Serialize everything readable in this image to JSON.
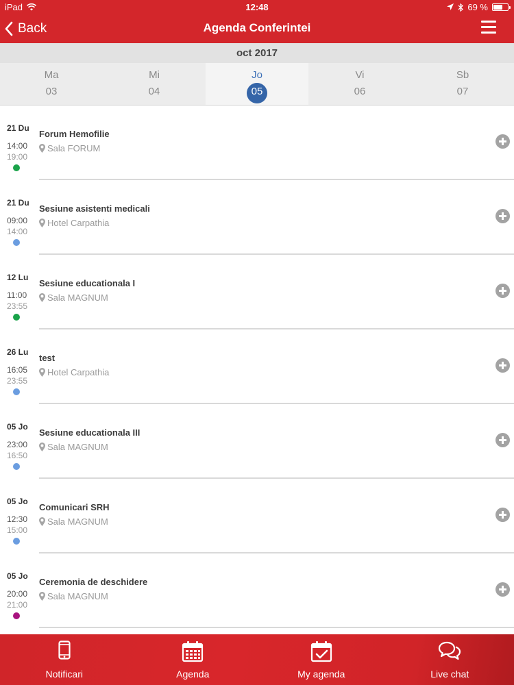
{
  "status": {
    "device": "iPad",
    "time": "12:48",
    "battery": "69 %",
    "battery_level": 0.69
  },
  "nav": {
    "back_label": "Back",
    "title": "Agenda Conferintei"
  },
  "calendar": {
    "month": "oct 2017",
    "days": [
      {
        "name": "Ma",
        "num": "03"
      },
      {
        "name": "Mi",
        "num": "04"
      },
      {
        "name": "Jo",
        "num": "05",
        "selected": true
      },
      {
        "name": "Vi",
        "num": "06"
      },
      {
        "name": "Sb",
        "num": "07"
      }
    ]
  },
  "events": [
    {
      "date": "21 Du",
      "start": "14:00",
      "end": "19:00",
      "title": "Forum Hemofilie",
      "location": "Sala FORUM",
      "dot_color": "#1aa34a"
    },
    {
      "date": "21 Du",
      "start": "09:00",
      "end": "14:00",
      "title": "Sesiune asistenti medicali",
      "location": "Hotel Carpathia",
      "dot_color": "#6b9de0"
    },
    {
      "date": "12 Lu",
      "start": "11:00",
      "end": "23:55",
      "title": "Sesiune educationala I",
      "location": "Sala MAGNUM",
      "dot_color": "#1aa34a"
    },
    {
      "date": "26 Lu",
      "start": "16:05",
      "end": "23:55",
      "title": "test",
      "location": "Hotel Carpathia",
      "dot_color": "#6b9de0"
    },
    {
      "date": "05 Jo",
      "start": "23:00",
      "end": "16:50",
      "title": "Sesiune educationala III",
      "location": "Sala MAGNUM",
      "dot_color": "#6b9de0"
    },
    {
      "date": "05 Jo",
      "start": "12:30",
      "end": "15:00",
      "title": "Comunicari SRH",
      "location": "Sala MAGNUM",
      "dot_color": "#6b9de0"
    },
    {
      "date": "05 Jo",
      "start": "20:00",
      "end": "21:00",
      "title": "Ceremonia de deschidere",
      "location": "Sala MAGNUM",
      "dot_color": "#a8137f"
    }
  ],
  "tabs": [
    {
      "label": "Notificari",
      "icon": "phone-icon"
    },
    {
      "label": "Agenda",
      "icon": "calendar-icon"
    },
    {
      "label": "My agenda",
      "icon": "calendar-check-icon"
    },
    {
      "label": "Live chat",
      "icon": "chat-icon"
    }
  ],
  "colors": {
    "brand_red": "#d3262b",
    "selected_blue": "#3565a8"
  }
}
